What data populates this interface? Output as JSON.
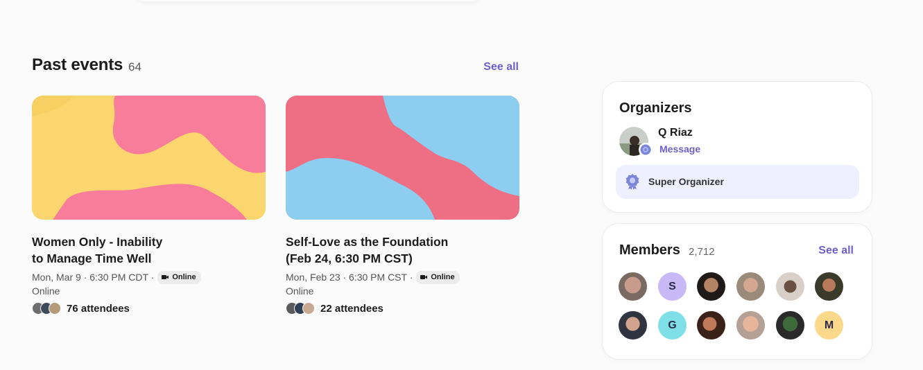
{
  "past_events": {
    "title": "Past events",
    "count": "64",
    "see_all": "See all",
    "events": [
      {
        "title_line1": "Women Only - Inability",
        "title_line2": "to Manage Time Well",
        "date": "Mon, Mar 9 · 6:30 PM CDT ·",
        "badge": "Online",
        "location": "Online",
        "attendees": "76 attendees"
      },
      {
        "title_line1": "Self-Love as the Foundation",
        "title_line2": "(Feb 24, 6:30 PM CST)",
        "date": "Mon, Feb 23 · 6:30 PM CST ·",
        "badge": "Online",
        "location": "Online",
        "attendees": "22 attendees"
      }
    ]
  },
  "organizers": {
    "title": "Organizers",
    "name": "Q Riaz",
    "message": "Message",
    "role": "Super Organizer"
  },
  "members": {
    "title": "Members",
    "count": "2,712",
    "see_all": "See all",
    "letters": [
      "S",
      "G",
      "M"
    ]
  },
  "colors": {
    "accent": "#6b5fc9",
    "badge_bg": "#eef0ff"
  }
}
